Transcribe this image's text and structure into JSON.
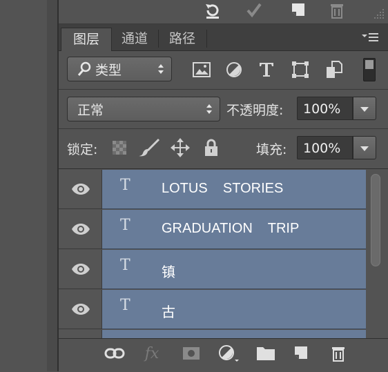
{
  "tabs": [
    {
      "label": "图层"
    },
    {
      "label": "通道"
    },
    {
      "label": "路径"
    }
  ],
  "filter": {
    "label": "类型"
  },
  "blend": {
    "mode": "正常",
    "opacity_label": "不透明度:",
    "opacity_value": "100%"
  },
  "lock": {
    "label": "锁定:",
    "fill_label": "填充:",
    "fill_value": "100%"
  },
  "layers": [
    {
      "type_glyph": "T",
      "name": "LOTUS    STORIES"
    },
    {
      "type_glyph": "T",
      "name": "GRADUATION    TRIP"
    },
    {
      "type_glyph": "T",
      "name": "镇"
    },
    {
      "type_glyph": "T",
      "name": "古"
    }
  ],
  "bottom": {
    "fx_label": "fx"
  },
  "colors": {
    "selected_layer": "#687c99",
    "panel_bg": "#535353"
  }
}
